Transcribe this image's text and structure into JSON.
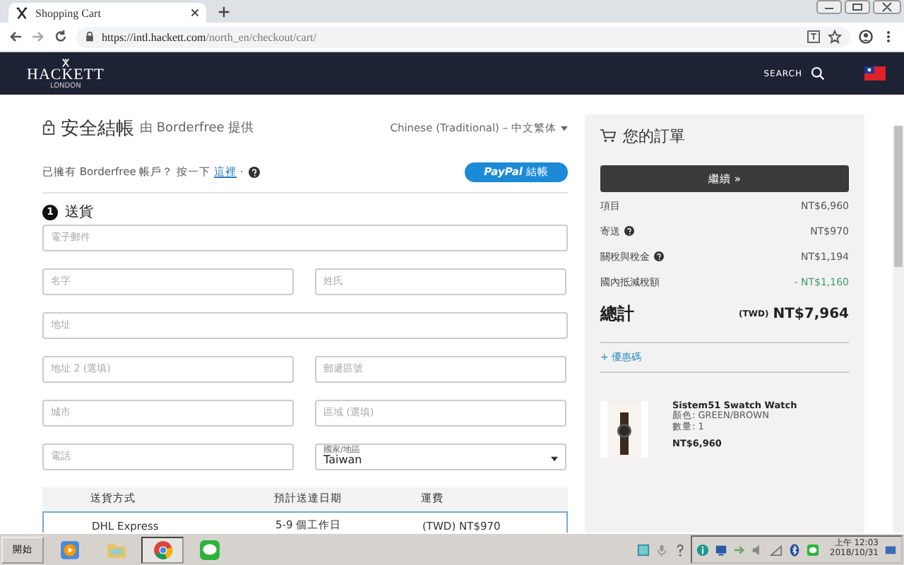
{
  "browser": {
    "tab": {
      "title": "Shopping Cart",
      "selected": true
    },
    "url": {
      "host": "https://intl.hackett.com",
      "path": "/north_en/checkout/cart/"
    }
  },
  "header": {
    "brand": "HACKETT",
    "brand_sub": "LONDON",
    "search": "SEARCH"
  },
  "checkout": {
    "title": "安全結帳",
    "provider": "由 Borderfree 提供",
    "language": "Chinese (Traditional) – 中文繁体",
    "login": {
      "before": "已擁有 Borderfree 帳戶？ 按一下",
      "link": "這裡",
      "after": "·"
    },
    "paypal": {
      "brand": "PayPal",
      "label": "結帳"
    },
    "step": {
      "number": "1",
      "title": "送貨"
    },
    "field_rows": [
      [
        {
          "kind": "text",
          "placeholder": "電子郵件"
        }
      ],
      [
        {
          "kind": "text",
          "placeholder": "名字"
        },
        {
          "kind": "text",
          "placeholder": "姓氏"
        }
      ],
      [
        {
          "kind": "text",
          "placeholder": "地址"
        }
      ],
      [
        {
          "kind": "text",
          "placeholder": "地址 2 (選填)"
        },
        {
          "kind": "text",
          "placeholder": "郵遞區號"
        }
      ],
      [
        {
          "kind": "text",
          "placeholder": "城市"
        },
        {
          "kind": "text",
          "placeholder": "區域 (選填)"
        }
      ],
      [
        {
          "kind": "text",
          "placeholder": "電話"
        },
        {
          "kind": "select",
          "label": "國家/地區",
          "value": "Taiwan"
        }
      ]
    ],
    "shipping": {
      "columns": [
        "送貨方式",
        "預計送達日期",
        "運費"
      ],
      "rows": [
        {
          "cells": [
            "DHL Express",
            "5-9 個工作日",
            "(TWD) NT$970"
          ],
          "selected": true
        }
      ]
    }
  },
  "order": {
    "title": "您的訂單",
    "button": "繼續 »",
    "lines": [
      {
        "label": "項目",
        "help": false,
        "value": "NT$6,960",
        "discount": false
      },
      {
        "label": "寄送",
        "help": true,
        "value": "NT$970",
        "discount": false
      },
      {
        "label": "關稅與稅金",
        "help": true,
        "value": "NT$1,194",
        "discount": false
      },
      {
        "label": "國內抵減稅額",
        "help": false,
        "value": "- NT$1,160",
        "discount": true
      }
    ],
    "total": {
      "label": "總計",
      "currency": "(TWD)",
      "value": "NT$7,964"
    },
    "coupon": "+ 優惠碼",
    "product": {
      "name": "Sistem51 Swatch Watch",
      "variant": "顏色: GREEN/BROWN",
      "quantity": "數量: 1",
      "price": "NT$6,960"
    }
  },
  "taskbar": {
    "start": "開始",
    "apps": [
      {
        "kind": "media",
        "selected": false
      },
      {
        "kind": "folder",
        "selected": false
      },
      {
        "kind": "browser",
        "selected": true
      },
      {
        "kind": "chat",
        "selected": false
      }
    ],
    "time": "上午 12:03",
    "date": "2018/10/31"
  }
}
